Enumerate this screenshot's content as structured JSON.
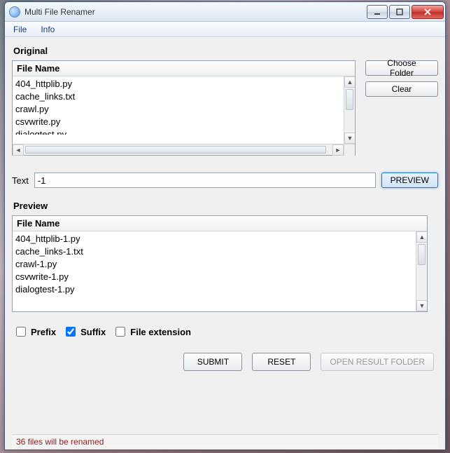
{
  "window": {
    "title": "Multi File Renamer"
  },
  "menu": {
    "file": "File",
    "info": "Info"
  },
  "labels": {
    "original": "Original",
    "preview": "Preview",
    "text": "Text",
    "file_name_col": "File Name"
  },
  "buttons": {
    "choose_folder": "Choose Folder",
    "clear": "Clear",
    "preview": "PREVIEW",
    "submit": "SUBMIT",
    "reset": "RESET",
    "open_result": "OPEN RESULT FOLDER"
  },
  "text_input": {
    "value": "-1"
  },
  "checks": {
    "prefix_label": "Prefix",
    "suffix_label": "Suffix",
    "file_ext_label": "File extension",
    "prefix_checked": false,
    "suffix_checked": true,
    "file_ext_checked": false
  },
  "original_list": [
    "404_httplib.py",
    "cache_links.txt",
    "crawl.py",
    "csvwrite.py",
    "dialogtest.py"
  ],
  "preview_list": [
    "404_httplib-1.py",
    "cache_links-1.txt",
    "crawl-1.py",
    "csvwrite-1.py",
    "dialogtest-1.py"
  ],
  "status": "36 files will be renamed"
}
